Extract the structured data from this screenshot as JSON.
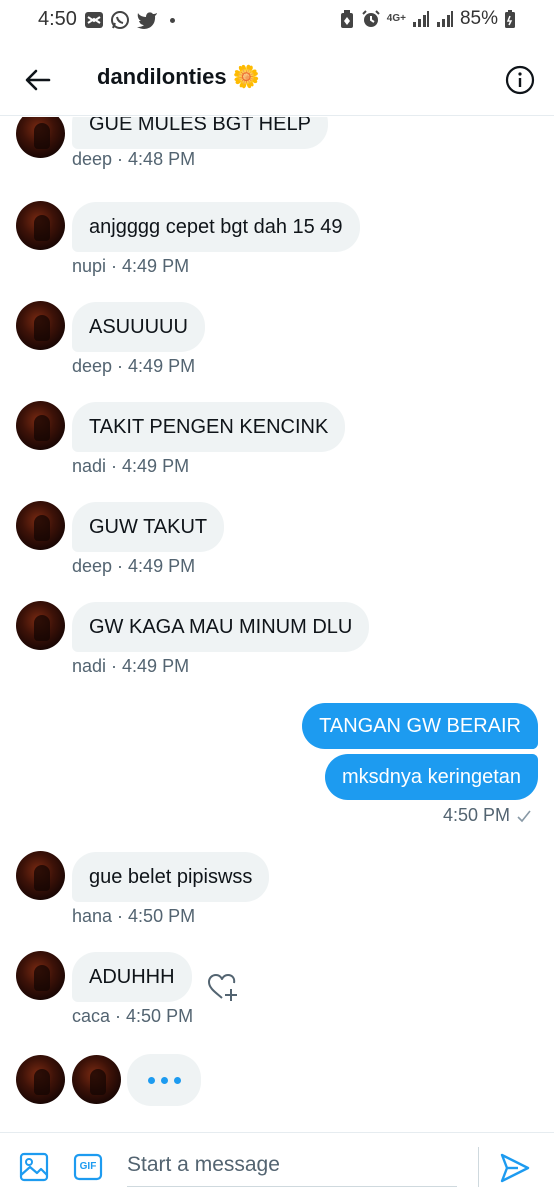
{
  "status_bar": {
    "time": "4:50",
    "battery": "85%",
    "network": "4G+"
  },
  "header": {
    "title": "dandilonties",
    "title_emoji": "🌼",
    "back_icon": "arrow-left-icon",
    "info_icon": "info-icon"
  },
  "messages": [
    {
      "text": "GUE MULES BGT HELP",
      "sender": "deep",
      "time": "4:48 PM"
    },
    {
      "text": "anjgggg cepet bgt dah 15 49",
      "sender": "nupi",
      "time": "4:49 PM"
    },
    {
      "text": "ASUUUUU",
      "sender": "deep",
      "time": "4:49 PM"
    },
    {
      "text": "TAKIT PENGEN KENCINK",
      "sender": "nadi",
      "time": "4:49 PM"
    },
    {
      "text": "GUW TAKUT",
      "sender": "deep",
      "time": "4:49 PM"
    },
    {
      "text": "GW KAGA MAU MINUM DLU",
      "sender": "nadi",
      "time": "4:49 PM"
    },
    {
      "text": "gue belet pipiswss",
      "sender": "hana",
      "time": "4:50 PM"
    },
    {
      "text": "ADUHHH",
      "sender": "caca",
      "time": "4:50 PM"
    }
  ],
  "outgoing": {
    "messages": [
      "TANGAN GW BERAIR",
      "mksdnya keringetan"
    ],
    "time": "4:50 PM",
    "status_icon": "check-icon"
  },
  "meta_separator": " · ",
  "composer": {
    "placeholder": "Start a message",
    "gif_label": "GIF"
  },
  "colors": {
    "accent": "#1d9bf0",
    "incoming_bubble": "#eff3f4",
    "meta_text": "#536471"
  }
}
